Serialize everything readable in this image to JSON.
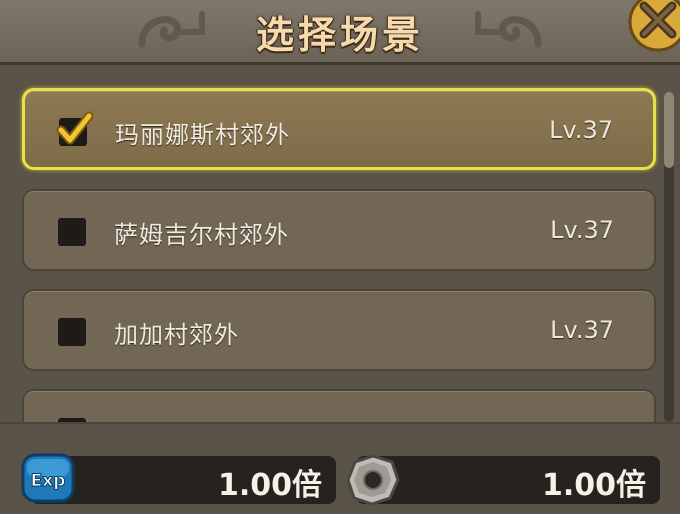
{
  "header": {
    "title": "选择场景"
  },
  "scenes": [
    {
      "name": "玛丽娜斯村郊外",
      "level": "Lv.37",
      "checked": true
    },
    {
      "name": "萨姆吉尔村郊外",
      "level": "Lv.37",
      "checked": false
    },
    {
      "name": "加加村郊外",
      "level": "Lv.37",
      "checked": false
    }
  ],
  "bottom": {
    "exp_label": "Exp",
    "exp_multiplier": "1.00倍",
    "drop_multiplier": "1.00倍"
  },
  "colors": {
    "selected_border": "#e8e14a",
    "title_text": "#f6d9ad",
    "checkmark": "#f2c533"
  }
}
